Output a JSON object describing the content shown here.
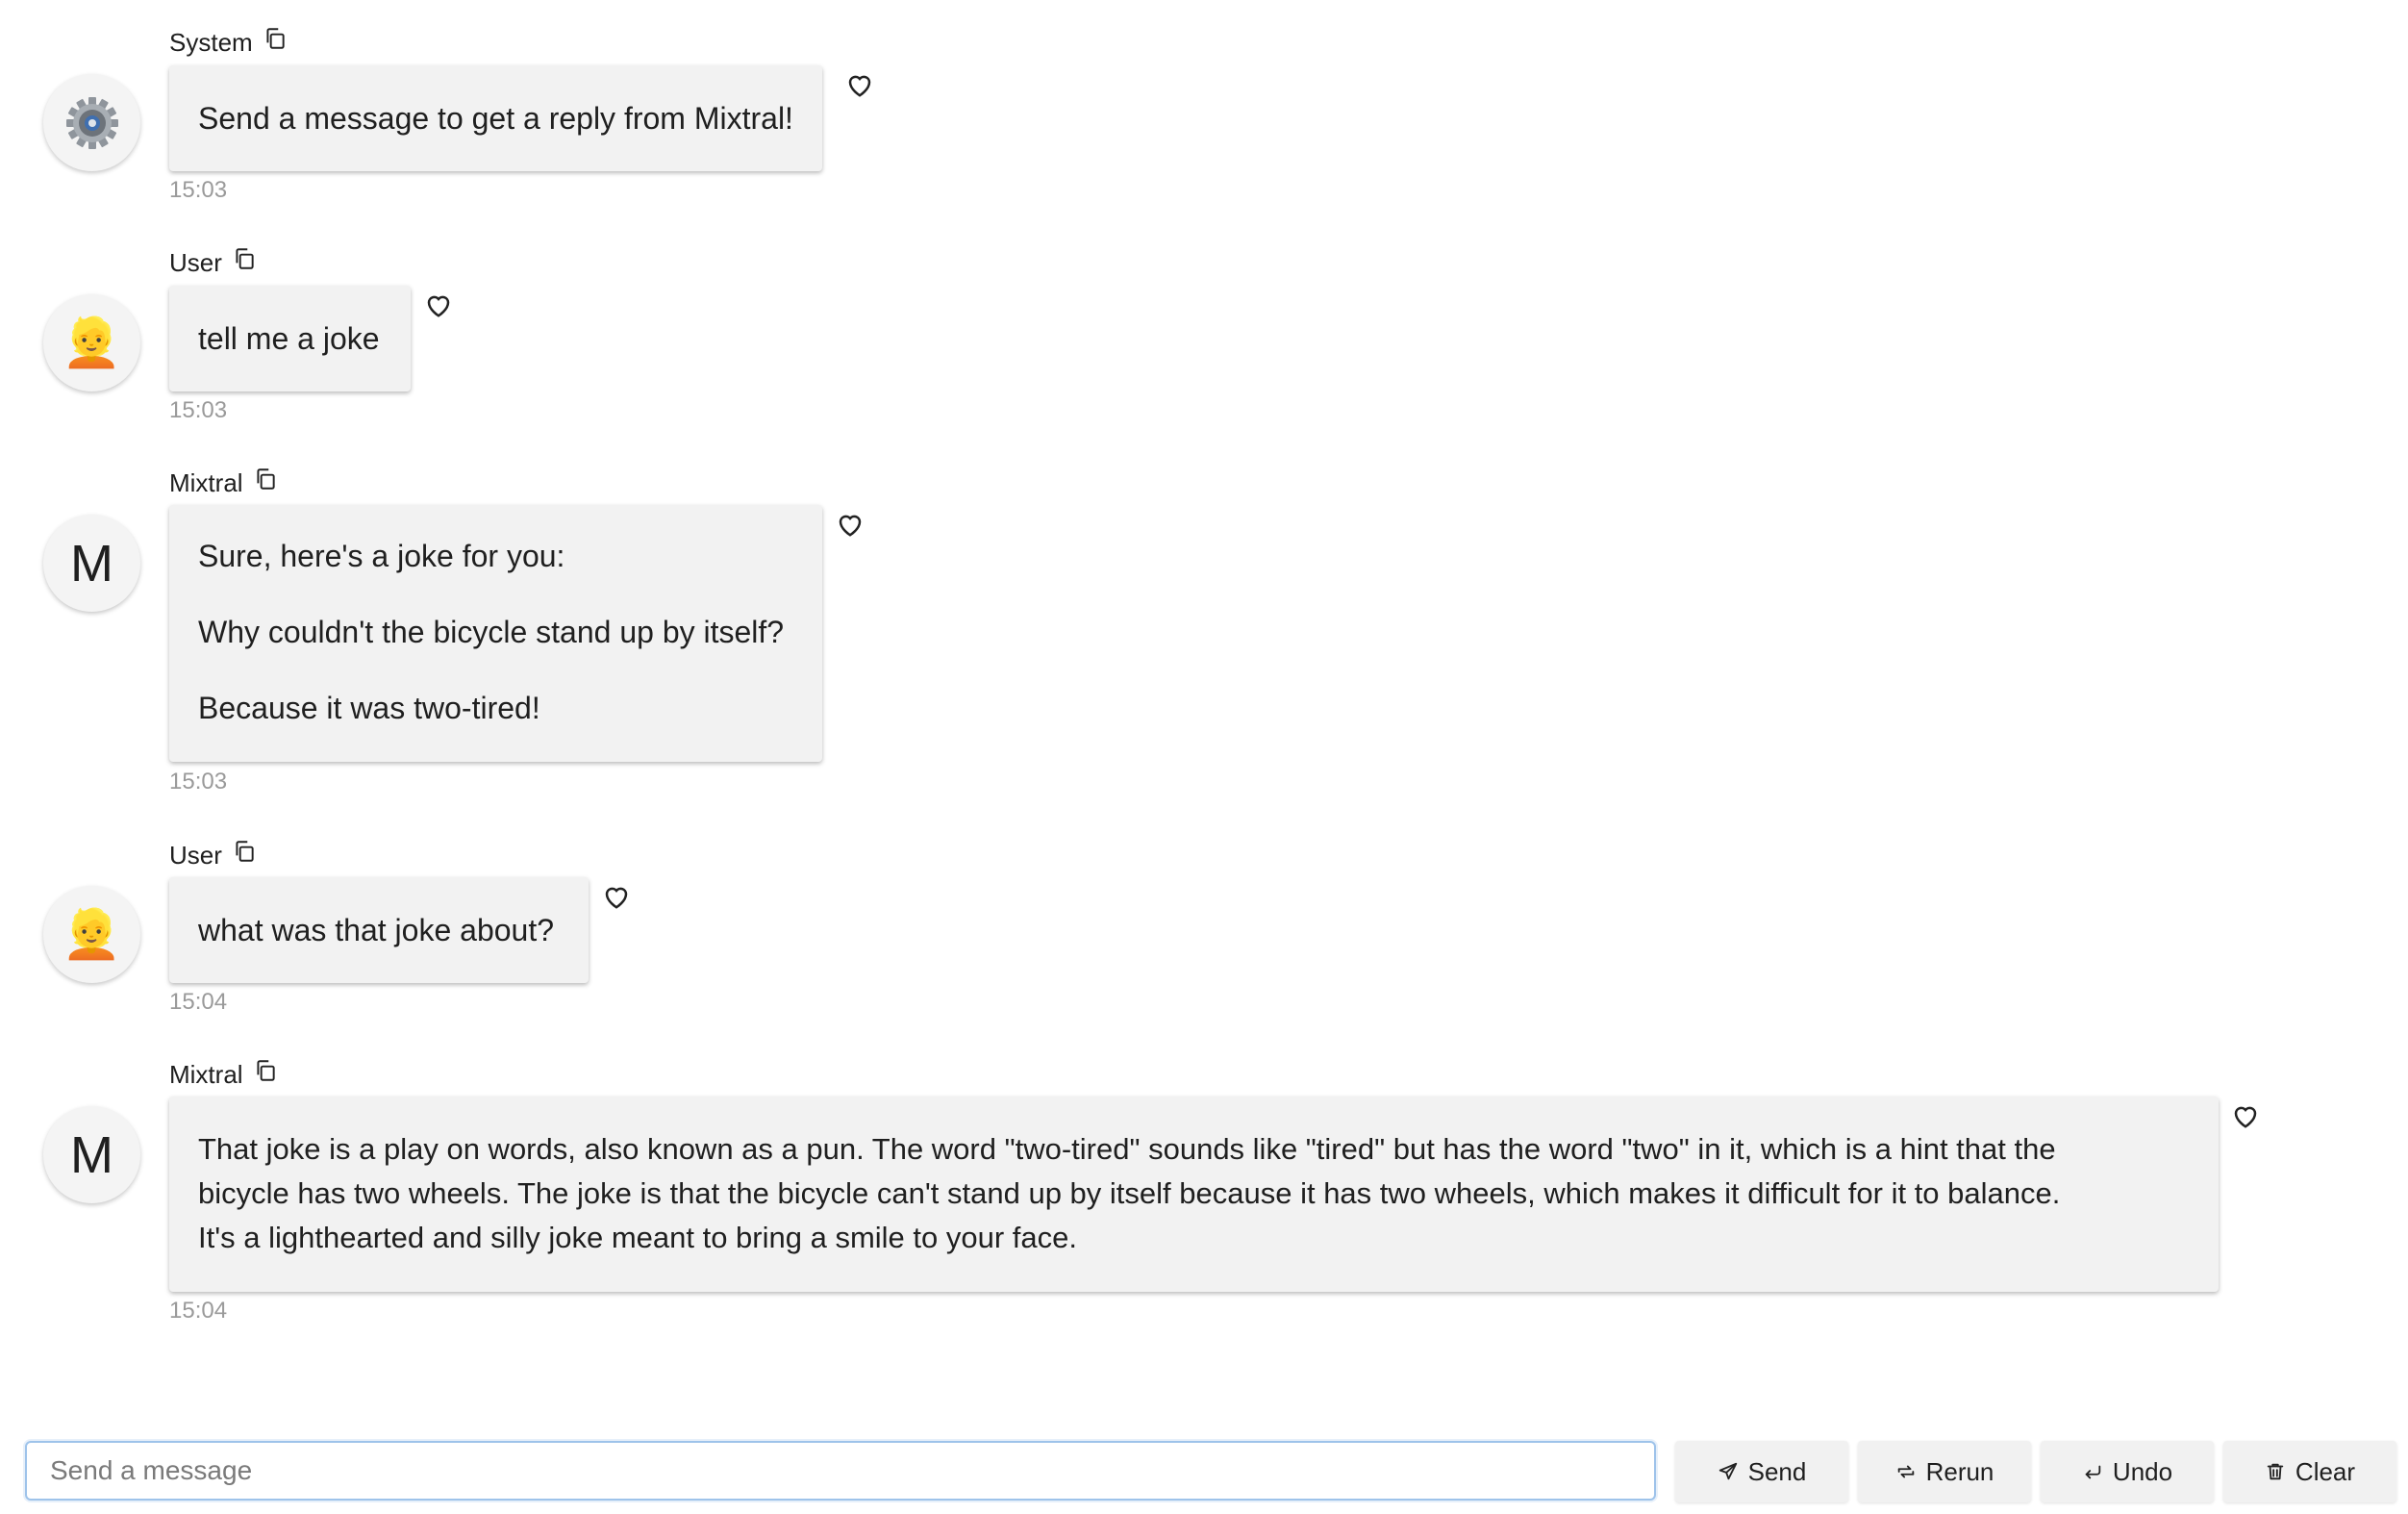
{
  "messages": [
    {
      "sender": "System",
      "avatar": "gear-icon",
      "lines": [
        "Send a message to get a reply from Mixtral!"
      ],
      "time": "15:03"
    },
    {
      "sender": "User",
      "avatar": "person-emoji",
      "avatar_glyph": "👱",
      "lines": [
        "tell me a joke"
      ],
      "time": "15:03"
    },
    {
      "sender": "Mixtral",
      "avatar": "letter-avatar",
      "avatar_letter": "M",
      "lines": [
        "Sure, here's a joke for you:",
        "Why couldn't the bicycle stand up by itself?",
        "Because it was two-tired!"
      ],
      "time": "15:03"
    },
    {
      "sender": "User",
      "avatar": "person-emoji",
      "avatar_glyph": "👱",
      "lines": [
        "what was that joke about?"
      ],
      "time": "15:04"
    },
    {
      "sender": "Mixtral",
      "avatar": "letter-avatar",
      "avatar_letter": "M",
      "lines": [
        "That joke is a play on words, also known as a pun. The word \"two-tired\" sounds like \"tired\" but has the word \"two\" in it, which is a hint that the",
        "bicycle has two wheels. The joke is that the bicycle can't stand up by itself because it has two wheels, which makes it difficult for it to balance.",
        "It's a lighthearted and silly joke meant to bring a smile to your face."
      ],
      "time": "15:04"
    }
  ],
  "composer": {
    "placeholder": "Send a message",
    "value": ""
  },
  "buttons": {
    "send": {
      "label": "Send",
      "icon": "send-icon"
    },
    "rerun": {
      "label": "Rerun",
      "icon": "rerun-icon"
    },
    "undo": {
      "label": "Undo",
      "icon": "undo-icon"
    },
    "clear": {
      "label": "Clear",
      "icon": "trash-icon"
    }
  },
  "colors": {
    "bubble": "#f2f2f2",
    "timestamp": "#9a9a9a",
    "focus_border": "#9ec3ea",
    "button": "#f1f1f1"
  }
}
